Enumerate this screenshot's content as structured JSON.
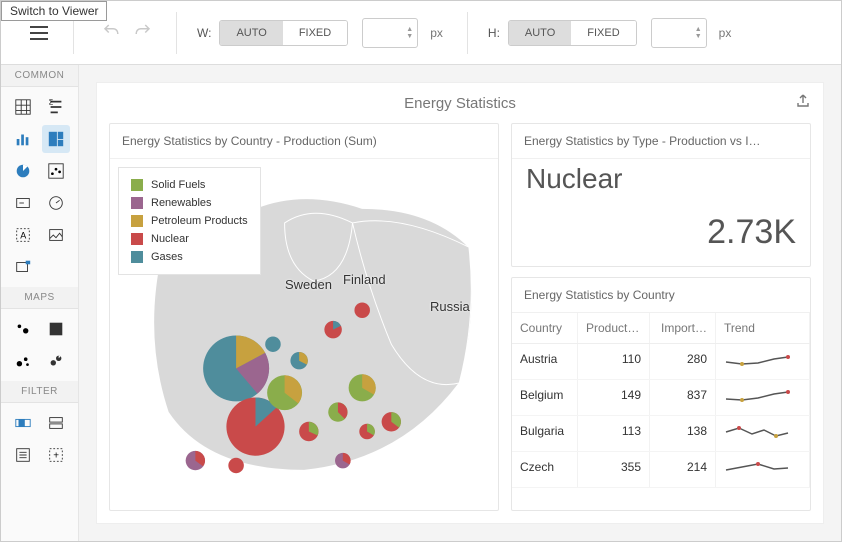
{
  "tooltip": "Switch to Viewer",
  "toolbar": {
    "width_label": "W:",
    "height_label": "H:",
    "auto": "AUTO",
    "fixed": "FIXED",
    "unit": "px"
  },
  "sidebar": {
    "cat_common": "COMMON",
    "cat_maps": "MAPS",
    "cat_filter": "FILTER"
  },
  "dash": {
    "title": "Energy Statistics",
    "map_title": "Energy Statistics by Country - Production (Sum)",
    "card_title": "Energy Statistics by Type - Production vs I…",
    "table_title": "Energy Statistics by Country"
  },
  "legend": {
    "items": [
      {
        "label": "Solid Fuels",
        "color": "#8aad4b"
      },
      {
        "label": "Renewables",
        "color": "#9b668f"
      },
      {
        "label": "Petroleum Products",
        "color": "#c7a13f"
      },
      {
        "label": "Nuclear",
        "color": "#c94a4a"
      },
      {
        "label": "Gases",
        "color": "#4f8d9c"
      }
    ]
  },
  "map_labels": {
    "sweden": "Sweden",
    "finland": "Finland",
    "russia": "Russia"
  },
  "card": {
    "type": "Nuclear",
    "value": "2.73K"
  },
  "table": {
    "cols": [
      "Country",
      "Producti…",
      "Import…",
      "Trend"
    ],
    "rows": [
      {
        "country": "Austria",
        "prod": "110",
        "imp": "280"
      },
      {
        "country": "Belgium",
        "prod": "149",
        "imp": "837"
      },
      {
        "country": "Bulgaria",
        "prod": "113",
        "imp": "138"
      },
      {
        "country": "Czech",
        "prod": "355",
        "imp": "214"
      }
    ]
  },
  "chart_data": {
    "type": "map",
    "title": "Energy Statistics by Country - Production (Sum)",
    "legend": [
      "Solid Fuels",
      "Renewables",
      "Petroleum Products",
      "Nuclear",
      "Gases"
    ],
    "note": "Pie markers per European country; sizes proportional to total production; slice colors per legend. Exact per-country breakdowns not labeled in source image."
  }
}
